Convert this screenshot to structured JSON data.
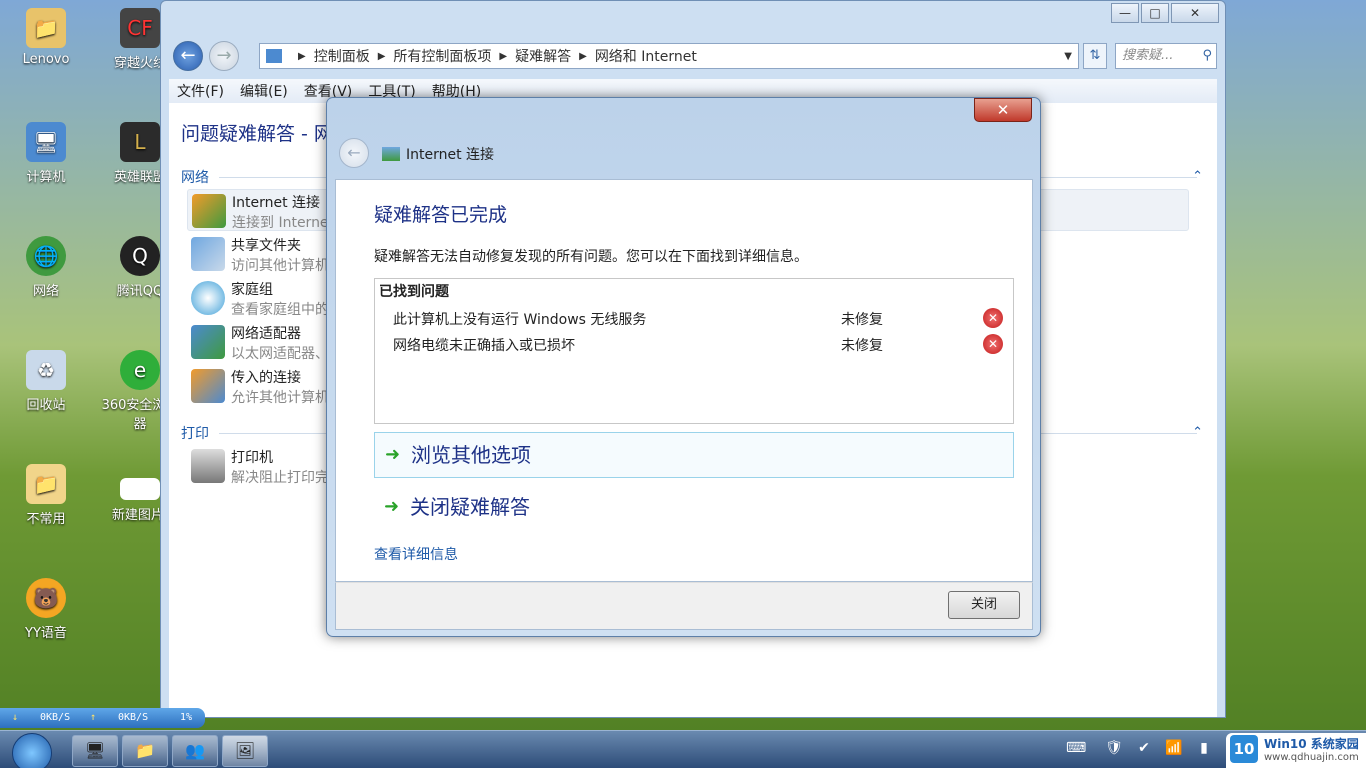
{
  "desktop": {
    "icons": [
      {
        "label": "Lenovo",
        "icon": "user-folder-icon"
      },
      {
        "label": "穿越火线",
        "icon": "game-cf-icon"
      },
      {
        "label": "计算机",
        "icon": "computer-icon"
      },
      {
        "label": "英雄联盟",
        "icon": "game-lol-icon"
      },
      {
        "label": "网络",
        "icon": "network-globe-icon"
      },
      {
        "label": "腾讯QQ",
        "icon": "qq-penguin-icon"
      },
      {
        "label": "回收站",
        "icon": "recycle-bin-icon"
      },
      {
        "label": "360安全浏览器",
        "icon": "browser-360-icon"
      },
      {
        "label": "不常用",
        "icon": "folder-icon"
      },
      {
        "label": "新建图片.",
        "icon": "image-file-icon"
      },
      {
        "label": "YY语音",
        "icon": "yy-voice-icon"
      }
    ]
  },
  "explorer": {
    "breadcrumb": [
      "控制面板",
      "所有控制面板项",
      "疑难解答",
      "网络和 Internet"
    ],
    "search_placeholder": "搜索疑...",
    "menu": [
      "文件(F)",
      "编辑(E)",
      "查看(V)",
      "工具(T)",
      "帮助(H)"
    ],
    "title": "问题疑难解答 - 网",
    "groups": [
      {
        "label": "网络",
        "items": [
          {
            "title": "Internet 连接",
            "desc": "连接到 Interne"
          },
          {
            "title": "共享文件夹",
            "desc": "访问其他计算机"
          },
          {
            "title": "家庭组",
            "desc": "查看家庭组中的"
          },
          {
            "title": "网络适配器",
            "desc": "以太网适配器、"
          },
          {
            "title": "传入的连接",
            "desc": "允许其他计算机"
          }
        ]
      },
      {
        "label": "打印",
        "items": [
          {
            "title": "打印机",
            "desc": "解决阻止打印完"
          }
        ]
      }
    ]
  },
  "dialog": {
    "window_title": "Internet 连接",
    "heading": "疑难解答已完成",
    "message": "疑难解答无法自动修复发现的所有问题。您可以在下面找到详细信息。",
    "problems_header": "已找到问题",
    "problems": [
      {
        "text": "此计算机上没有运行 Windows 无线服务",
        "status": "未修复"
      },
      {
        "text": "网络电缆未正确插入或已损坏",
        "status": "未修复"
      }
    ],
    "options": [
      "浏览其他选项",
      "关闭疑难解答"
    ],
    "details_link": "查看详细信息",
    "close_button": "关闭"
  },
  "speed_widget": {
    "down": "0KB/S",
    "up": "0KB/S",
    "percent": "1%"
  },
  "brand": {
    "logo": "10",
    "name": "Win10 系统家园",
    "url": "www.qdhuajin.com"
  }
}
